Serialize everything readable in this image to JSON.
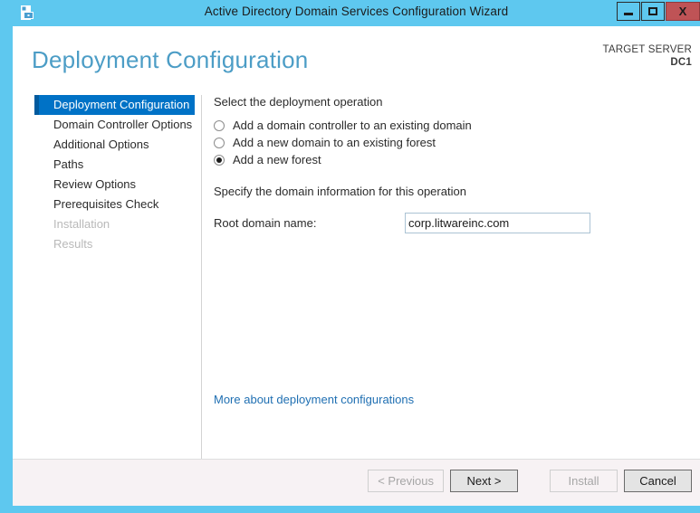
{
  "window": {
    "title": "Active Directory Domain Services Configuration Wizard",
    "icon": "server-wizard-icon",
    "controls": {
      "minimize": "minimize-icon",
      "maximize": "maximize-icon",
      "close": "X"
    },
    "border_color": "#5ec8ef",
    "titlebar_color": "#5ec8ef",
    "close_color": "#bf5356"
  },
  "header": {
    "page_title": "Deployment Configuration",
    "target_label": "TARGET SERVER",
    "target_value": "DC1",
    "title_color": "#4c9dc6"
  },
  "sidebar": {
    "accent_color": "#0072c6",
    "items": [
      {
        "label": "Deployment Configuration",
        "state": "selected"
      },
      {
        "label": "Domain Controller Options",
        "state": "enabled"
      },
      {
        "label": "Additional Options",
        "state": "enabled"
      },
      {
        "label": "Paths",
        "state": "enabled"
      },
      {
        "label": "Review Options",
        "state": "enabled"
      },
      {
        "label": "Prerequisites Check",
        "state": "enabled"
      },
      {
        "label": "Installation",
        "state": "disabled"
      },
      {
        "label": "Results",
        "state": "disabled"
      }
    ]
  },
  "main": {
    "operation_section_label": "Select the deployment operation",
    "operations": [
      {
        "label": "Add a domain controller to an existing domain",
        "checked": false
      },
      {
        "label": "Add a new domain to an existing forest",
        "checked": false
      },
      {
        "label": "Add a new forest",
        "checked": true
      }
    ],
    "domain_section_label": "Specify the domain information for this operation",
    "root_domain_label": "Root domain name:",
    "root_domain_value": "corp.litwareinc.com",
    "root_domain_placeholder": "",
    "help_link": "More about deployment configurations",
    "link_color": "#1f6fb2"
  },
  "footer": {
    "buttons": [
      {
        "label": "< Previous",
        "state": "disabled"
      },
      {
        "label": "Next >",
        "state": "enabled"
      },
      {
        "label": "Install",
        "state": "disabled"
      },
      {
        "label": "Cancel",
        "state": "enabled"
      }
    ]
  }
}
